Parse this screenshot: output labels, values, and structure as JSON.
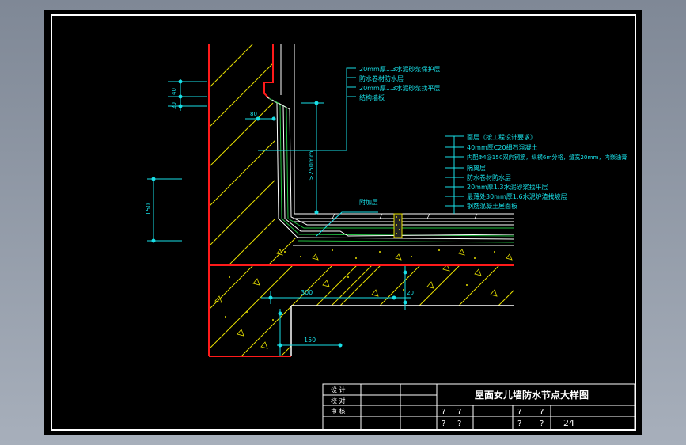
{
  "drawing": {
    "title": "屋面女儿墙防水节点大样图",
    "sheet_number": "24",
    "title_block_labels": [
      "设 计",
      "校 对",
      "审 核"
    ],
    "title_block_marks": [
      "?",
      "?",
      "?",
      "?",
      "?",
      "?",
      "?",
      "?"
    ]
  },
  "wall_leaders": [
    "20mm厚1.3水泥砂浆保护层",
    "防水卷材防水层",
    "20mm厚1.3水泥砂浆找平层",
    "结构墙板"
  ],
  "roof_leaders": [
    "面层（按工程设计要求）",
    "40mm厚C20细石混凝土",
    "内配Φ4@150双向钢筋，纵横6m分格，缝宽20mm，内嵌油膏",
    "隔离层",
    "防水卷材防水层",
    "20mm厚1.3水泥砂浆找平层",
    "最薄处30mm厚1:6水泥炉渣找坡层",
    "钢筋混凝土屋面板"
  ],
  "callout_added_layer": "附加层",
  "dimensions": {
    "d40": "40",
    "d20a": "20",
    "d80": "80",
    "d250": ">250mm",
    "d150v": "150",
    "d300": "300",
    "d20b": "20",
    "d150h": "150"
  },
  "colors": {
    "frame_white": "#ffffff",
    "wall_red": "#ff1a1a",
    "dimension_cyan": "#18e0e8",
    "hatch_yellow": "#e8e000",
    "layer_green": "#20c040",
    "text_white": "#ffffff"
  }
}
